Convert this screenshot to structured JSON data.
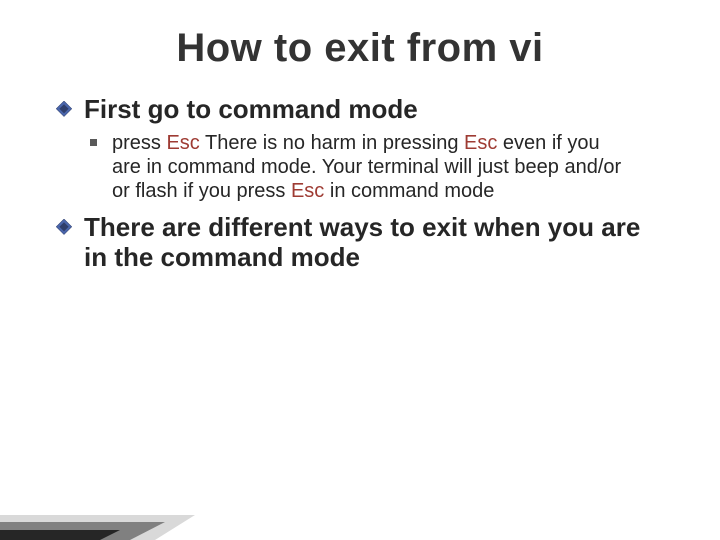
{
  "title": "How to exit from vi",
  "bullets": [
    {
      "text": "First go to command mode",
      "sub": [
        {
          "parts": [
            {
              "t": "press ",
              "esc": false
            },
            {
              "t": "Esc",
              "esc": true
            },
            {
              "t": " There is no harm in pressing ",
              "esc": false
            },
            {
              "t": "Esc",
              "esc": true
            },
            {
              "t": " even if you are in command mode. Your terminal will just beep and/or or flash if you press ",
              "esc": false
            },
            {
              "t": "Esc",
              "esc": true
            },
            {
              "t": " in command mode",
              "esc": false
            }
          ]
        }
      ]
    },
    {
      "text": "There are different ways to exit when you are in the command mode",
      "sub": []
    }
  ]
}
